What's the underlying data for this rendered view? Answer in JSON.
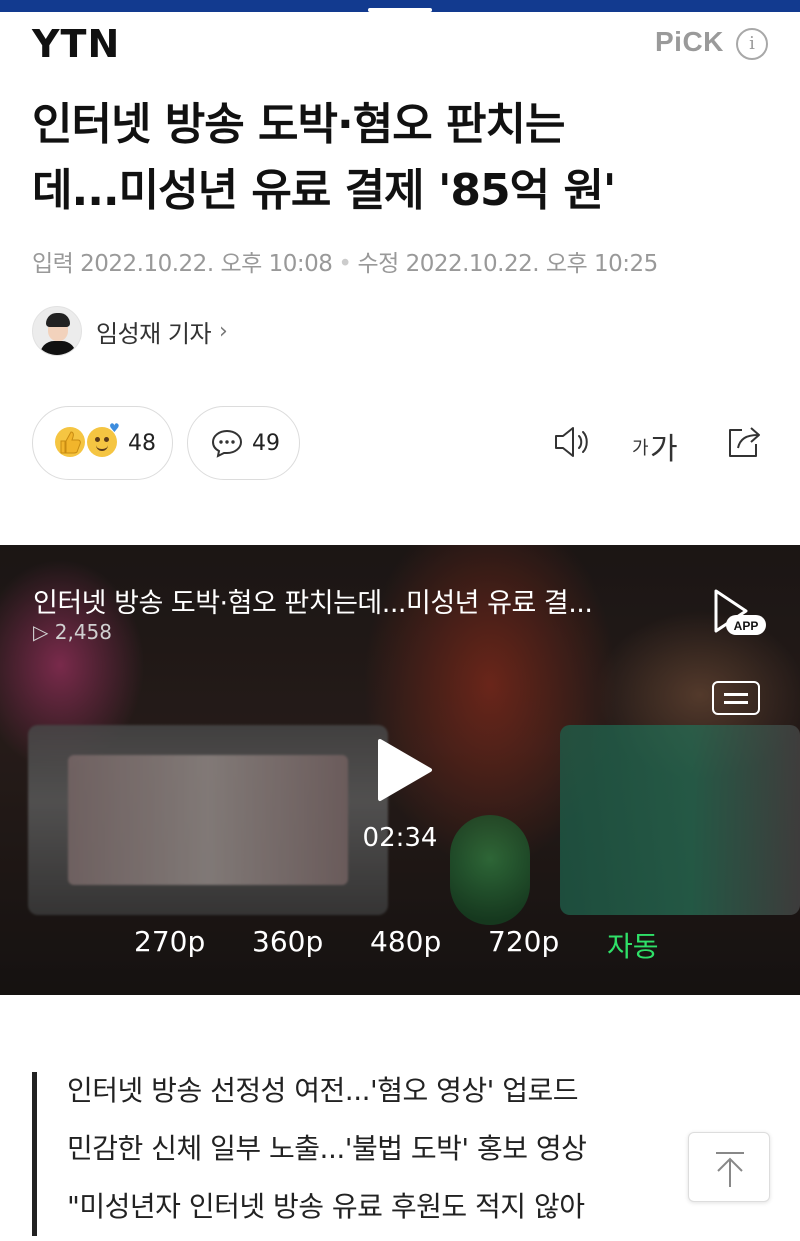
{
  "header": {
    "logo": "YTN",
    "pick_label": "PiCK",
    "info_label": "i"
  },
  "article": {
    "title_line1": "인터넷 방송 도박·혐오 판치는",
    "title_line2": "데...미성년 유료 결제 '85억 원'",
    "published": "입력 2022.10.22. 오후 10:08",
    "modified": "수정 2022.10.22. 오후 10:25",
    "reporter": "임성재 기자"
  },
  "reactions": {
    "like_count": "48",
    "comment_count": "49",
    "font_size_label_small": "가",
    "font_size_label_large": "가"
  },
  "video": {
    "title": "인터넷 방송 도박·혐오 판치는데...미성년 유료 결...",
    "views": "2,458",
    "app_badge": "APP",
    "duration": "02:34",
    "qualities": [
      "270p",
      "360p",
      "480p",
      "720p",
      "자동"
    ],
    "selected_quality": "자동"
  },
  "summary": {
    "lines": [
      "인터넷 방송 선정성 여전...'혐오 영상' 업로드",
      "민감한 신체 일부 노출...'불법 도박' 홍보 영상",
      "\"미성년자 인터넷 방송 유료 후원도 적지 않아"
    ]
  },
  "colors": {
    "top_bar": "#123a8f",
    "auto_quality": "#2fe068"
  },
  "icons": [
    "speaker-icon",
    "font-size-icon",
    "share-icon",
    "comment-icon",
    "play-icon",
    "menu-icon",
    "arrow-up-icon"
  ]
}
